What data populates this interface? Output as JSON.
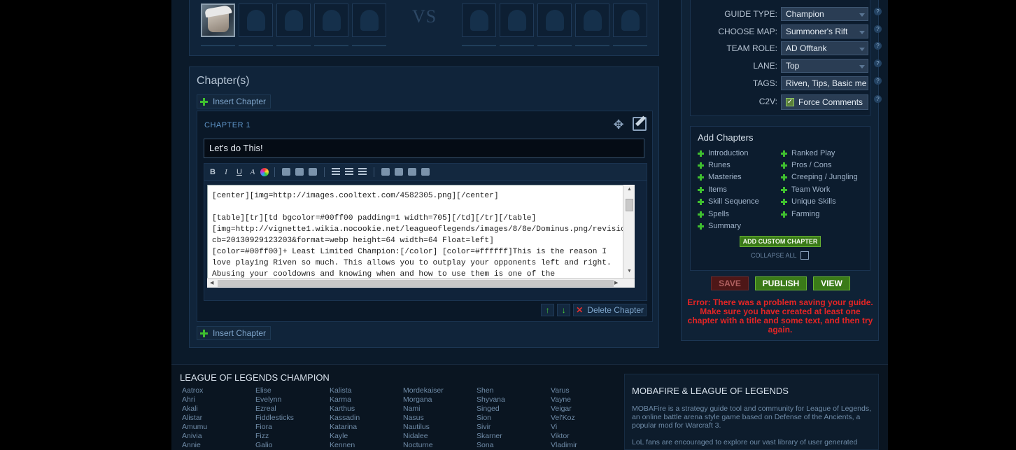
{
  "team": {
    "vs_label": "VS"
  },
  "chapters_panel": {
    "title": "Chapter(s)",
    "insert_chapter_label": "Insert Chapter",
    "chapter": {
      "label": "CHAPTER 1",
      "title_value": "Let's do This!",
      "body_text": "[center][img=http://images.cooltext.com/4582305.png][/center]\n\n[table][tr][td bgcolor=#00ff00 padding=1 width=705][/td][/tr][/table]\n[img=http://vignette1.wikia.nocookie.net/leagueoflegends/images/8/8e/Dominus.png/revision/latest?cb=20130929123203&format=webp height=64 width=64 Float=left]\n[color=#00ff00]+ Least Limited Champion:[/color] [color=#ffffff]This is the reason I love playing Riven so much. This allows you to outplay your opponents left and right. Abusing your cooldowns and knowing when and how to use them is one of the",
      "delete_label": "Delete Chapter"
    },
    "toolbar": {
      "bold": "B",
      "italic": "I",
      "underline": "U",
      "font": "A"
    }
  },
  "guide_form": {
    "guide_type": {
      "label": "GUIDE TYPE:",
      "value": "Champion"
    },
    "choose_map": {
      "label": "CHOOSE MAP:",
      "value": "Summoner's Rift"
    },
    "team_role": {
      "label": "TEAM ROLE:",
      "value": "AD Offtank"
    },
    "lane": {
      "label": "LANE:",
      "value": "Top"
    },
    "tags": {
      "label": "TAGS:",
      "value": "Riven, Tips, Basic me"
    },
    "c2v": {
      "label": "C2V:",
      "value": "Force Comments"
    },
    "help": "?"
  },
  "add_chapters": {
    "title": "Add Chapters",
    "left": [
      "Introduction",
      "Runes",
      "Masteries",
      "Items",
      "Skill Sequence",
      "Spells",
      "Summary"
    ],
    "right": [
      "Ranked Play",
      "Pros / Cons",
      "Creeping / Jungling",
      "Team Work",
      "Unique Skills",
      "Farming"
    ],
    "custom_button": "ADD CUSTOM CHAPTER",
    "collapse_all": "COLLAPSE ALL"
  },
  "actions": {
    "save": "SAVE",
    "publish": "PUBLISH",
    "view": "VIEW",
    "error": "Error: There was a problem saving your guide. Make sure you have created at least one chapter with a title and some text, and then try again."
  },
  "footer": {
    "champions_title": "LEAGUE OF LEGENDS CHAMPION",
    "champion_columns": [
      [
        "Aatrox",
        "Ahri",
        "Akali",
        "Alistar",
        "Amumu",
        "Anivia",
        "Annie"
      ],
      [
        "Elise",
        "Evelynn",
        "Ezreal",
        "Fiddlesticks",
        "Fiora",
        "Fizz",
        "Galio"
      ],
      [
        "Kalista",
        "Karma",
        "Karthus",
        "Kassadin",
        "Katarina",
        "Kayle",
        "Kennen"
      ],
      [
        "Mordekaiser",
        "Morgana",
        "Nami",
        "Nasus",
        "Nautilus",
        "Nidalee",
        "Nocturne"
      ],
      [
        "Shen",
        "Shyvana",
        "Singed",
        "Sion",
        "Sivir",
        "Skarner",
        "Sona"
      ],
      [
        "Varus",
        "Vayne",
        "Veigar",
        "Vel'Koz",
        "Vi",
        "Viktor",
        "Vladimir"
      ]
    ],
    "mobafire_title": "MOBAFIRE & LEAGUE OF LEGENDS",
    "mobafire_text": "MOBAFire is a strategy guide tool and community for League of Legends, an online battle arena style game based on Defense of the Ancients, a popular mod for Warcraft 3.",
    "mobafire_text2": "LoL fans are encouraged to explore our vast library of user generated"
  }
}
